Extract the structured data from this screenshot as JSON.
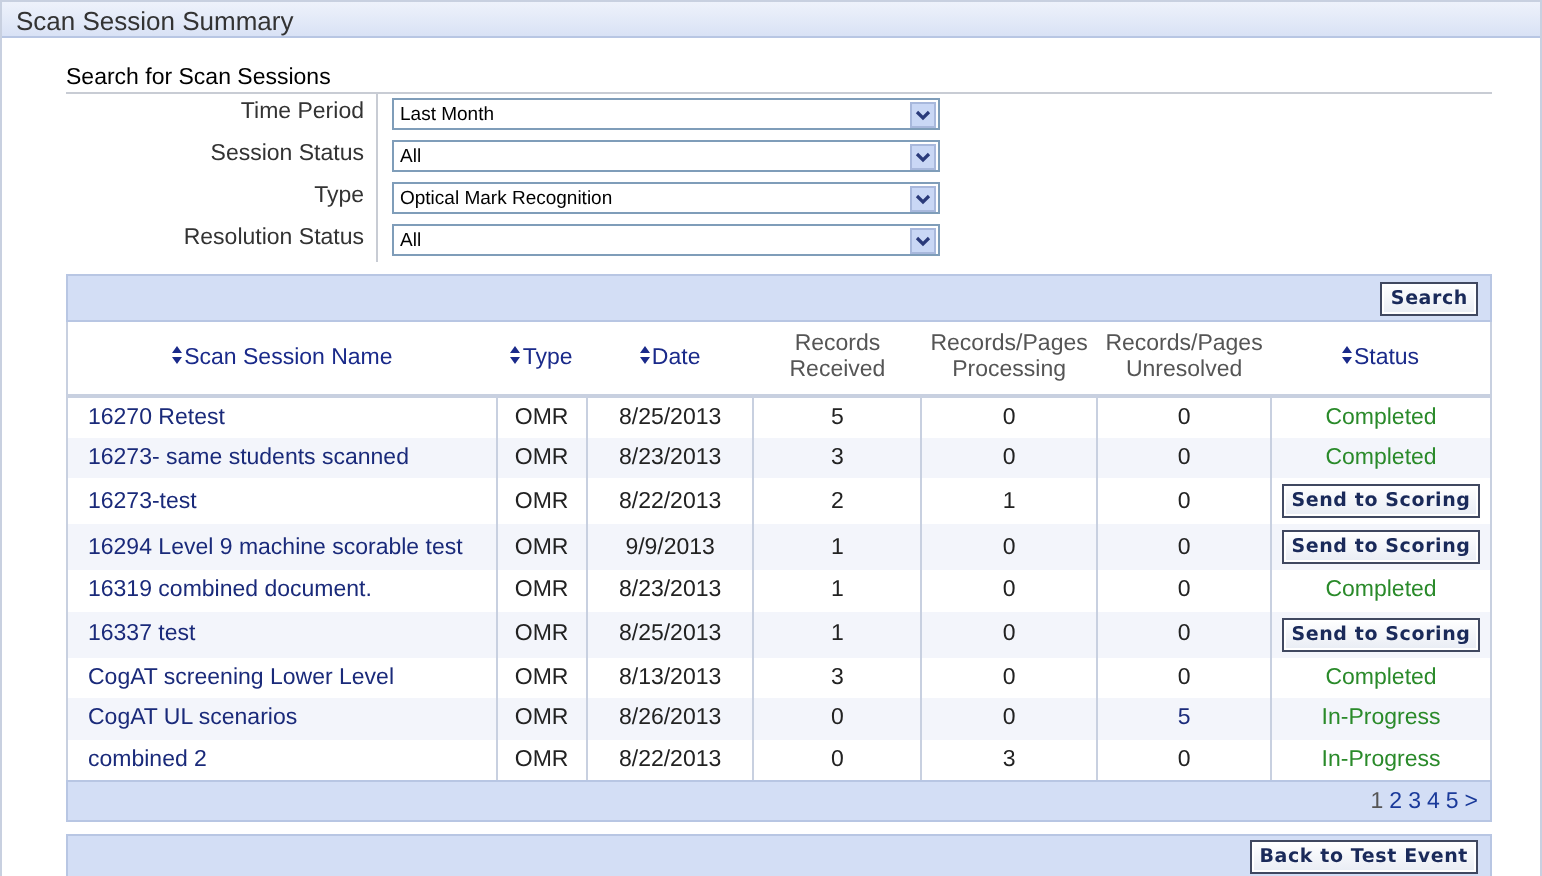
{
  "panel": {
    "title": "Scan Session Summary"
  },
  "search": {
    "heading": "Search for Scan Sessions",
    "filters": [
      {
        "label": "Time Period",
        "value": "Last Month"
      },
      {
        "label": "Session Status",
        "value": "All"
      },
      {
        "label": "Type",
        "value": "Optical Mark Recognition"
      },
      {
        "label": "Resolution Status",
        "value": "All"
      }
    ],
    "button": "Search"
  },
  "table": {
    "columns": [
      {
        "label": "Scan Session Name",
        "sortable": true
      },
      {
        "label": "Type",
        "sortable": true
      },
      {
        "label": "Date",
        "sortable": true
      },
      {
        "label": "Records Received",
        "sortable": false
      },
      {
        "label": "Records/Pages Processing",
        "sortable": false
      },
      {
        "label": "Records/Pages Unresolved",
        "sortable": false
      },
      {
        "label": "Status",
        "sortable": true
      }
    ],
    "rows": [
      {
        "name": "16270 Retest",
        "type": "OMR",
        "date": "8/25/2013",
        "received": "5",
        "processing": "0",
        "unresolved": {
          "value": "0",
          "link": false
        },
        "status": {
          "kind": "text",
          "label": "Completed"
        }
      },
      {
        "name": "16273- same students scanned",
        "type": "OMR",
        "date": "8/23/2013",
        "received": "3",
        "processing": "0",
        "unresolved": {
          "value": "0",
          "link": false
        },
        "status": {
          "kind": "text",
          "label": "Completed"
        }
      },
      {
        "name": "16273-test",
        "type": "OMR",
        "date": "8/22/2013",
        "received": "2",
        "processing": "1",
        "unresolved": {
          "value": "0",
          "link": false
        },
        "status": {
          "kind": "button",
          "label": "Send to Scoring"
        }
      },
      {
        "name": "16294 Level 9 machine scorable test",
        "type": "OMR",
        "date": "9/9/2013",
        "received": "1",
        "processing": "0",
        "unresolved": {
          "value": "0",
          "link": false
        },
        "status": {
          "kind": "button",
          "label": "Send to Scoring"
        }
      },
      {
        "name": "16319 combined document.",
        "type": "OMR",
        "date": "8/23/2013",
        "received": "1",
        "processing": "0",
        "unresolved": {
          "value": "0",
          "link": false
        },
        "status": {
          "kind": "text",
          "label": "Completed"
        }
      },
      {
        "name": "16337 test",
        "type": "OMR",
        "date": "8/25/2013",
        "received": "1",
        "processing": "0",
        "unresolved": {
          "value": "0",
          "link": false
        },
        "status": {
          "kind": "button",
          "label": "Send to Scoring"
        }
      },
      {
        "name": "CogAT screening Lower Level",
        "type": "OMR",
        "date": "8/13/2013",
        "received": "3",
        "processing": "0",
        "unresolved": {
          "value": "0",
          "link": false
        },
        "status": {
          "kind": "text",
          "label": "Completed"
        }
      },
      {
        "name": "CogAT UL scenarios",
        "type": "OMR",
        "date": "8/26/2013",
        "received": "0",
        "processing": "0",
        "unresolved": {
          "value": "5",
          "link": true
        },
        "status": {
          "kind": "text",
          "label": "In-Progress"
        }
      },
      {
        "name": "combined 2",
        "type": "OMR",
        "date": "8/22/2013",
        "received": "0",
        "processing": "3",
        "unresolved": {
          "value": "0",
          "link": false
        },
        "status": {
          "kind": "text",
          "label": "In-Progress"
        }
      }
    ],
    "pages": [
      {
        "label": "1",
        "selected": true
      },
      {
        "label": "2",
        "selected": false
      },
      {
        "label": "3",
        "selected": false
      },
      {
        "label": "4",
        "selected": false
      },
      {
        "label": "5",
        "selected": false
      }
    ],
    "next": ">"
  },
  "footer": {
    "button": "Back to Test Event"
  }
}
